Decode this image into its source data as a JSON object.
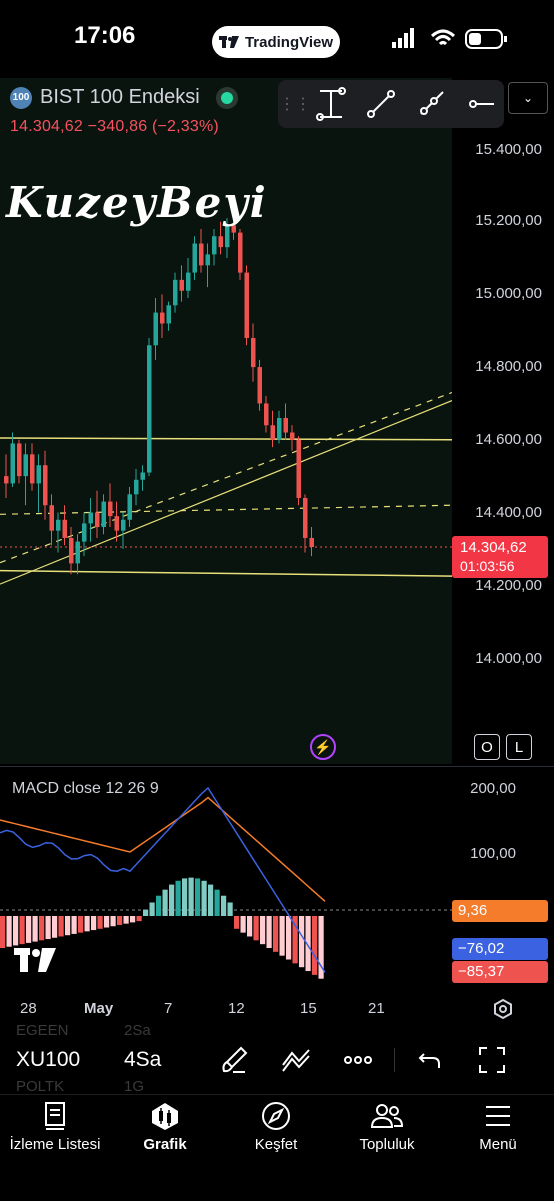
{
  "status_bar": {
    "time": "17:06",
    "pill_brand": "TradingView"
  },
  "symbol": {
    "badge": "100",
    "name": "BIST 100 Endeksi",
    "last": "14.304,62",
    "change": "−340,86",
    "change_pct": "(−2,33%)"
  },
  "watermark": "KuzeyBeyi",
  "price_axis": {
    "labels": [
      "15.400,00",
      "15.200,00",
      "15.000,00",
      "14.800,00",
      "14.600,00",
      "14.400,00",
      "14.200,00",
      "14.000,00"
    ]
  },
  "last_price_tag": {
    "price": "14.304,62",
    "countdown": "01:03:56"
  },
  "chart_buttons": {
    "o": "O",
    "l": "L"
  },
  "macd": {
    "title": "MACD close 12 26 9",
    "axis": [
      "200,00",
      "100,00"
    ],
    "hist_value": "9,36",
    "macd_value": "−76,02",
    "signal_value": "−85,37"
  },
  "time_axis": [
    "28",
    "May",
    "7",
    "12",
    "15",
    "21"
  ],
  "toolbar": {
    "symbol": "XU100",
    "interval": "4Sa",
    "ghost_top_symbol": "EGEEN",
    "ghost_top_interval": "2Sa",
    "ghost_bottom_symbol": "POLTK",
    "ghost_bottom_interval": "1G"
  },
  "nav": [
    {
      "label": "İzleme Listesi",
      "icon": "watchlist-icon"
    },
    {
      "label": "Grafik",
      "icon": "chart-icon"
    },
    {
      "label": "Keşfet",
      "icon": "compass-icon"
    },
    {
      "label": "Topluluk",
      "icon": "community-icon"
    },
    {
      "label": "Menü",
      "icon": "menu-icon"
    }
  ],
  "colors": {
    "up": "#26a69a",
    "down": "#ef5350",
    "accent_yellow": "#e8e07a",
    "macd_line": "#3b62e0",
    "signal_line": "#f57c2a"
  }
}
